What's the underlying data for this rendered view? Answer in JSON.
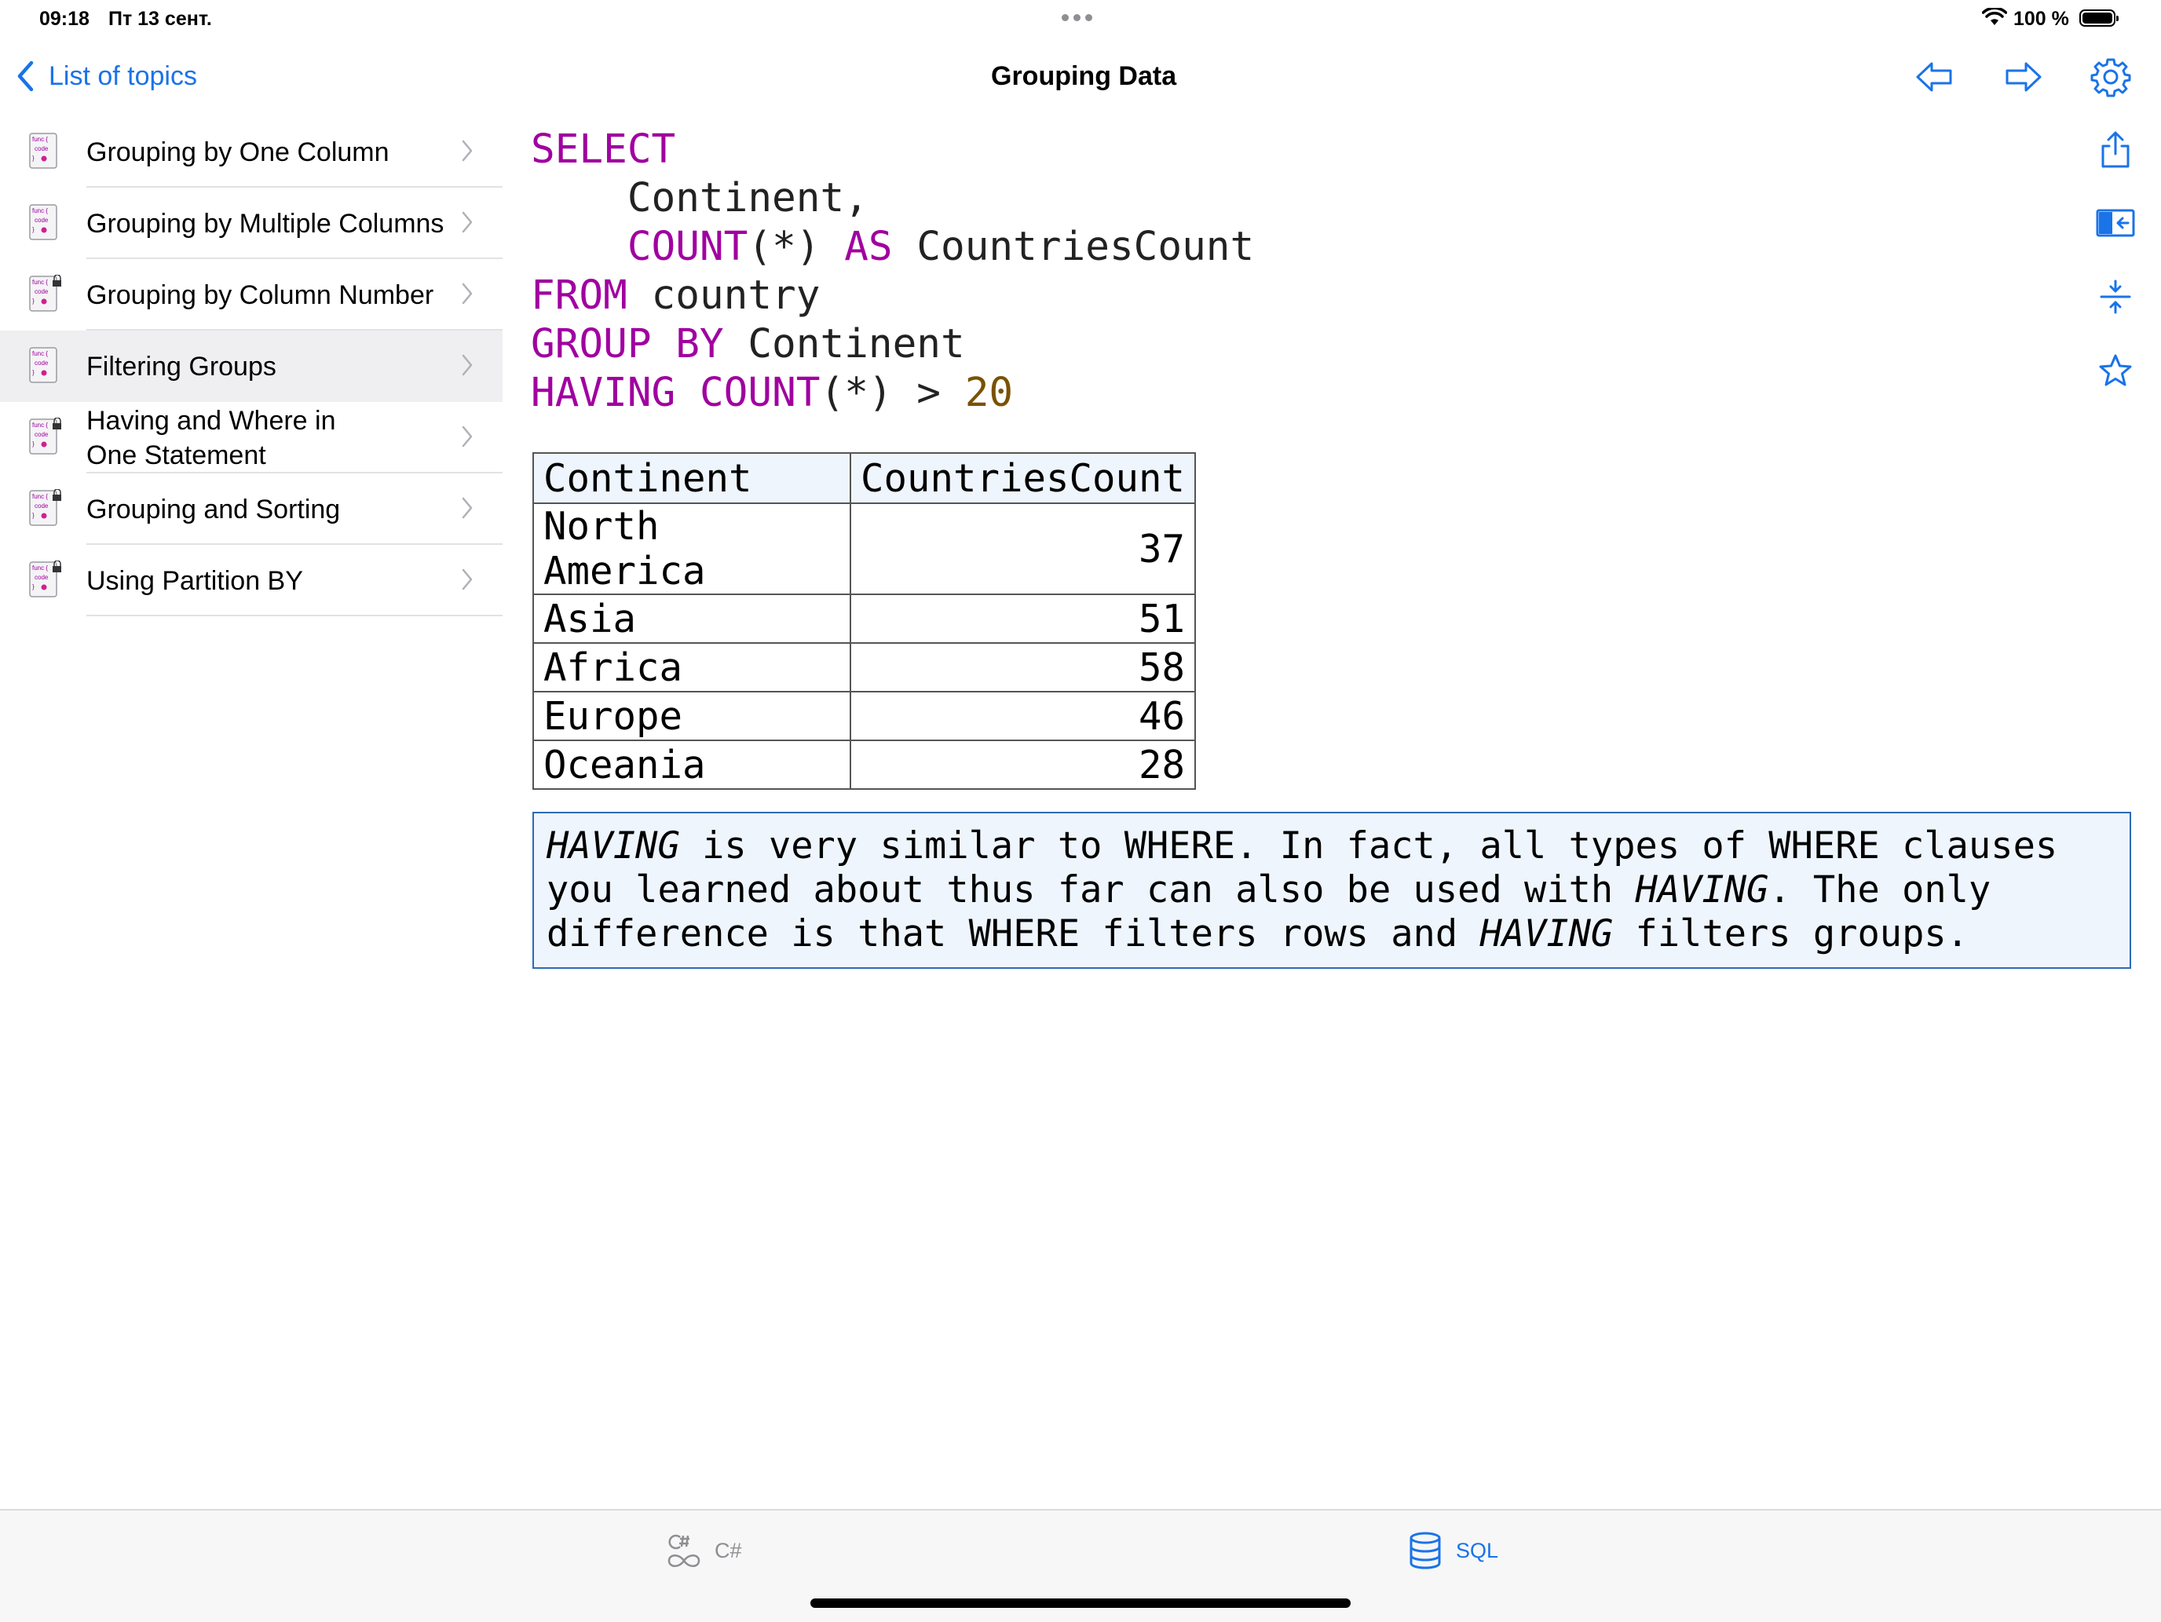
{
  "status_bar": {
    "time": "09:18",
    "date": "Пт 13 сент.",
    "battery": "100 %"
  },
  "nav": {
    "back_label": "List of topics",
    "title": "Grouping Data"
  },
  "sidebar": {
    "items": [
      {
        "label": "Grouping by One Column",
        "locked": false,
        "selected": false
      },
      {
        "label": "Grouping by Multiple Columns",
        "locked": false,
        "selected": false
      },
      {
        "label": "Grouping by Column Number",
        "locked": true,
        "selected": false
      },
      {
        "label": "Filtering Groups",
        "locked": false,
        "selected": true
      },
      {
        "label": "Having and Where in One Statement",
        "locked": true,
        "selected": false
      },
      {
        "label": "Grouping and Sorting",
        "locked": true,
        "selected": false
      },
      {
        "label": "Using Partition BY",
        "locked": true,
        "selected": false
      }
    ],
    "icon_text": [
      "func {",
      "code",
      "}"
    ]
  },
  "code": {
    "line1_kw": "SELECT",
    "line2_text": "    Continent,",
    "line3_kw1": "COUNT",
    "line3_text1": "(*) ",
    "line3_kw2": "AS",
    "line3_text2": " CountriesCount",
    "line4_kw": "FROM",
    "line4_text": " country",
    "line5_kw": "GROUP BY",
    "line5_text": " Continent",
    "line6_kw1": "HAVING",
    "line6_space": " ",
    "line6_kw2": "COUNT",
    "line6_text": "(*) > ",
    "line6_num": "20"
  },
  "result": {
    "headers": [
      "Continent",
      "CountriesCount"
    ],
    "rows": [
      [
        "North America",
        "37"
      ],
      [
        "Asia",
        "51"
      ],
      [
        "Africa",
        "58"
      ],
      [
        "Europe",
        "46"
      ],
      [
        "Oceania",
        "28"
      ]
    ]
  },
  "note": {
    "p1": "HAVING",
    "p2": " is very similar to WHERE. In fact, all types of WHERE clauses you learned about thus far can also be used with ",
    "p3": "HAVING",
    "p4": ". The only difference is that WHERE filters rows and ",
    "p5": "HAVING",
    "p6": " filters groups."
  },
  "tabs": [
    {
      "label": "C#",
      "active": false,
      "icon": "csharp-icon"
    },
    {
      "label": "SQL",
      "active": true,
      "icon": "database-icon"
    }
  ],
  "colors": {
    "accent": "#1a73e8",
    "keyword": "#a000a0",
    "number": "#7a5200",
    "note_border": "#2a6bb8",
    "note_bg": "#eef5fd"
  }
}
